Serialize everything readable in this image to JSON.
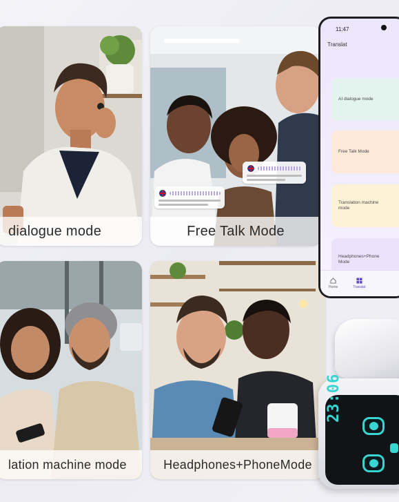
{
  "cards": [
    {
      "caption": "dialogue mode"
    },
    {
      "caption": "Free Talk Mode"
    },
    {
      "caption": "lation machine mode"
    },
    {
      "caption": "Headphones+PhoneMode"
    }
  ],
  "phone": {
    "time": "11:47",
    "title": "Translat",
    "modes": [
      {
        "label": "AI dialogue mode"
      },
      {
        "label": "Free Talk Mode"
      },
      {
        "label": "Translation machine mode"
      },
      {
        "label": "Headphones+Phone Mode"
      }
    ],
    "nav": [
      {
        "label": "Home",
        "icon": "home-icon"
      },
      {
        "label": "Translat",
        "icon": "grid-icon"
      }
    ]
  },
  "case_display": {
    "time": "23:06",
    "accent": "#37d6d0"
  },
  "colors": {
    "card_border": "#c9d6b4",
    "phone_accent": "#5a48c8"
  }
}
